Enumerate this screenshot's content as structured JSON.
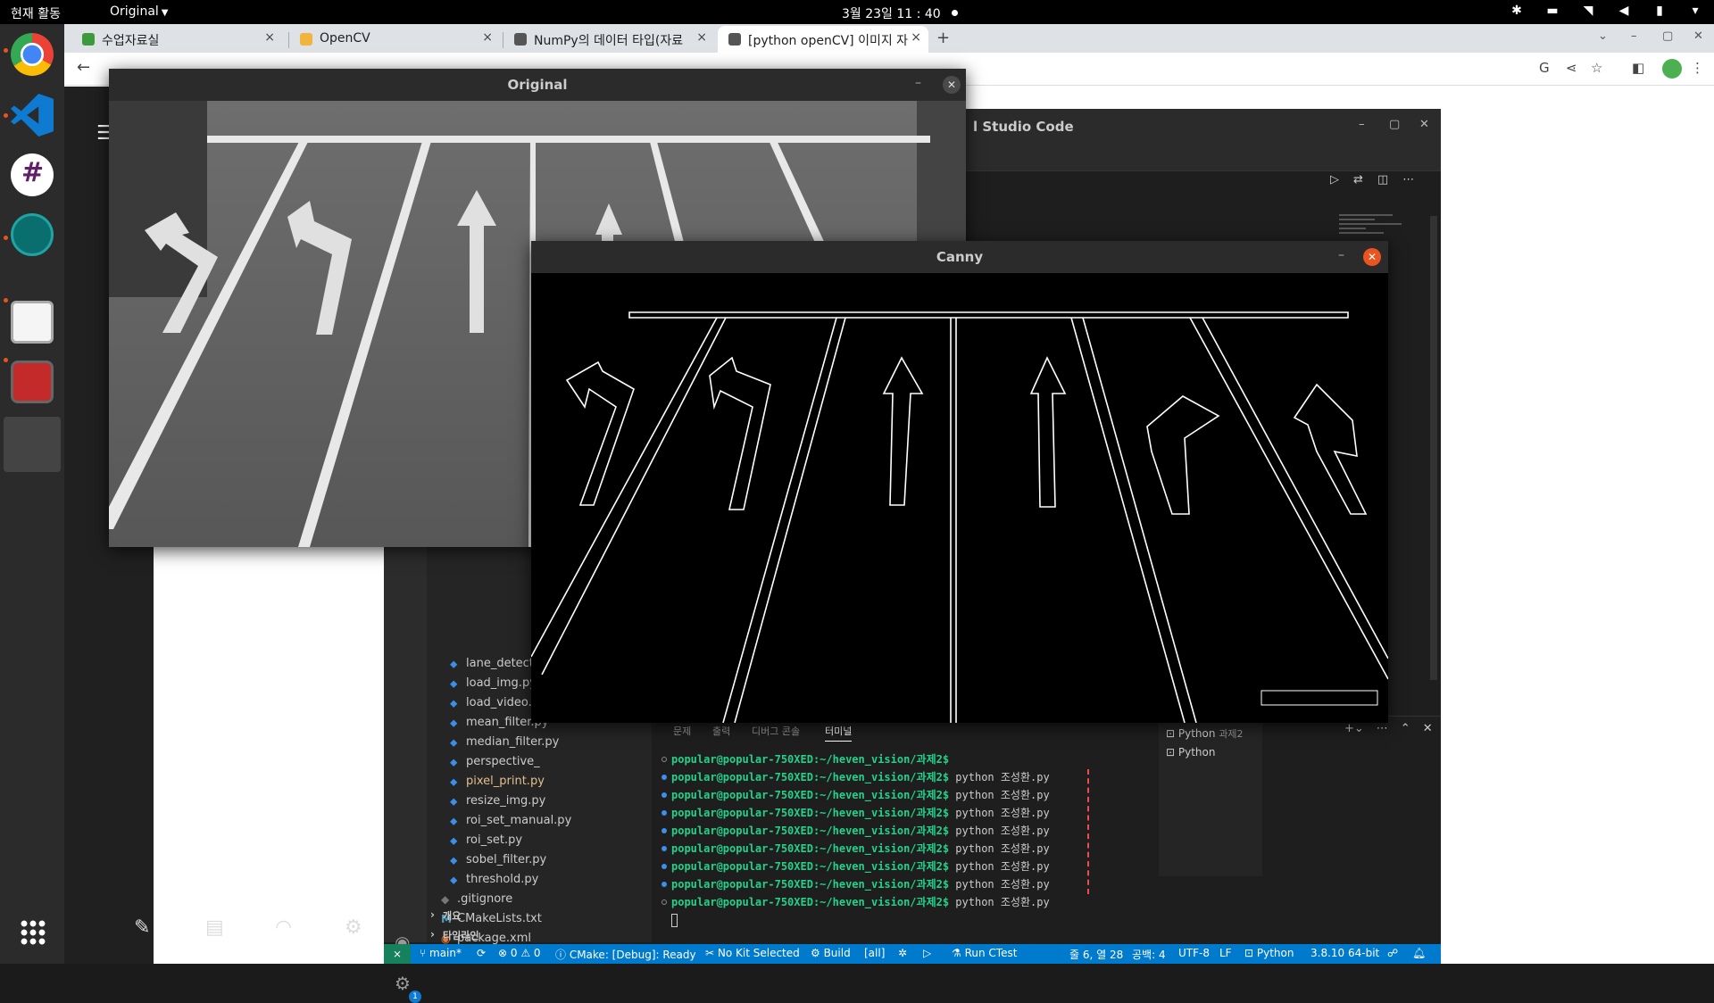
{
  "topbar": {
    "activities": "현재 활동",
    "app_menu": "Original",
    "clock": "3월 23일  11 : 40"
  },
  "dock": {
    "apps": [
      "chrome-icon",
      "vscode-icon",
      "slack-icon",
      "gitkraken-icon",
      "files-icon",
      "terminal-icon"
    ]
  },
  "browser": {
    "tabs": [
      {
        "title": "수업자료실",
        "close": "×"
      },
      {
        "title": "OpenCV",
        "close": "×"
      },
      {
        "title": "NumPy의 데이터 타입(자료",
        "close": "×"
      },
      {
        "title": "[python openCV] 이미지 자",
        "close": "×"
      }
    ],
    "new_tab": "+"
  },
  "vscode": {
    "title": "l Studio Code",
    "files": [
      {
        "name": "lane_detect.py",
        "modified": false
      },
      {
        "name": "load_img.py",
        "modified": false
      },
      {
        "name": "load_video.py",
        "modified": false
      },
      {
        "name": "mean_filter.py",
        "modified": false
      },
      {
        "name": "median_filter.py",
        "modified": false
      },
      {
        "name": "perspective_",
        "modified": false
      },
      {
        "name": "pixel_print.py",
        "modified": true
      },
      {
        "name": "resize_img.py",
        "modified": false
      },
      {
        "name": "roi_set_manual.py",
        "modified": false
      },
      {
        "name": "roi_set.py",
        "modified": false
      },
      {
        "name": "sobel_filter.py",
        "modified": false
      },
      {
        "name": "threshold.py",
        "modified": false
      }
    ],
    "root_files": [
      {
        "name": ".gitignore",
        "icon": "git"
      },
      {
        "name": "CMakeLists.txt",
        "icon": "M"
      },
      {
        "name": "package.xml",
        "icon": "rss"
      }
    ],
    "sections": [
      "개요",
      "타임라인"
    ],
    "panel_tabs": [
      "문제",
      "출력",
      "디버그 콘솔",
      "터미널"
    ],
    "terminal": {
      "prompt": "popular@popular-750XED:~/heven_vision/과제2$",
      "lines": [
        {
          "cmd": "",
          "marker": "hollow"
        },
        {
          "cmd": " python 조성환.py",
          "marker": "blue"
        },
        {
          "cmd": " python 조성환.py",
          "marker": "blue"
        },
        {
          "cmd": " python 조성환.py",
          "marker": "blue"
        },
        {
          "cmd": " python 조성환.py",
          "marker": "blue"
        },
        {
          "cmd": " python 조성환.py",
          "marker": "blue"
        },
        {
          "cmd": " python 조성환.py",
          "marker": "blue"
        },
        {
          "cmd": " python 조성환.py",
          "marker": "blue"
        },
        {
          "cmd": " python 조성환.py",
          "marker": "hollow"
        }
      ]
    },
    "terminal_list": [
      {
        "label": "Python",
        "sub": "과제2"
      },
      {
        "label": "Python",
        "sub": ""
      }
    ],
    "status": {
      "branch": "main*",
      "errors": "0",
      "warnings": "0",
      "cmake": "CMake: [Debug]: Ready",
      "kit": "No Kit Selected",
      "build": "Build",
      "target": "[all]",
      "ctest": "Run CTest",
      "position": "줄 6, 열 28",
      "spaces": "공백: 4",
      "encoding": "UTF-8",
      "eol": "LF",
      "language": "Python",
      "interpreter": "3.8.10 64-bit"
    }
  },
  "opencv": {
    "original_title": "Original",
    "canny_title": "Canny"
  },
  "colors": {
    "accent": "#007acc",
    "ubuntu_orange": "#e95420",
    "prompt_green": "#23d18b"
  }
}
